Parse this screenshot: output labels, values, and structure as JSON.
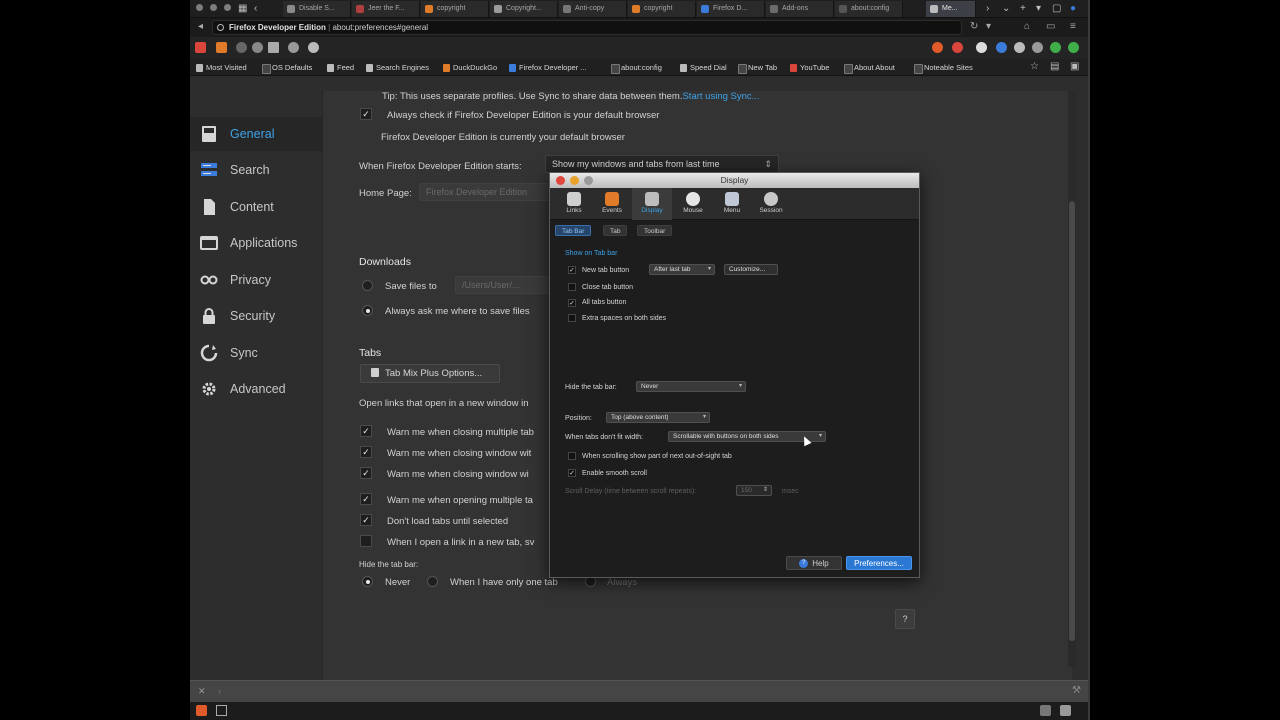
{
  "tabs": [
    {
      "label": "Disable S..."
    },
    {
      "label": "Jeer the F..."
    },
    {
      "label": "copyright"
    },
    {
      "label": "Copyright..."
    },
    {
      "label": "Anti-copy"
    },
    {
      "label": "copyright"
    },
    {
      "label": "Firefox D..."
    },
    {
      "label": "Add-ons"
    },
    {
      "label": "about:config"
    },
    {
      "label": "Me..."
    }
  ],
  "url_bar": {
    "site_name": "Firefox Developer Edition",
    "url": "about:preferences#general"
  },
  "bookmarks": [
    {
      "label": "Most Visited"
    },
    {
      "label": "OS Defaults"
    },
    {
      "label": "Feed"
    },
    {
      "label": "Search Engines"
    },
    {
      "label": "DuckDuckGo"
    },
    {
      "label": "Firefox Developer ..."
    },
    {
      "label": "about:config"
    },
    {
      "label": "Speed Dial"
    },
    {
      "label": "New Tab"
    },
    {
      "label": "YouTube"
    },
    {
      "label": "About About"
    },
    {
      "label": "Noteable Sites"
    }
  ],
  "sidebar": {
    "items": [
      {
        "label": "General",
        "icon": "general-icon"
      },
      {
        "label": "Search",
        "icon": "search-icon"
      },
      {
        "label": "Content",
        "icon": "content-icon"
      },
      {
        "label": "Applications",
        "icon": "applications-icon"
      },
      {
        "label": "Privacy",
        "icon": "privacy-mask-icon"
      },
      {
        "label": "Security",
        "icon": "lock-icon"
      },
      {
        "label": "Sync",
        "icon": "sync-icon"
      },
      {
        "label": "Advanced",
        "icon": "gear-icon"
      }
    ],
    "active_color": "#3da3e8"
  },
  "general": {
    "tip_text": "Tip: This uses separate profiles. Use Sync to share data between them.",
    "tip_link": "Start using Sync...",
    "default_check_label": "Always check if Firefox Developer Edition is your default browser",
    "default_status": "Firefox Developer Edition is currently your default browser",
    "starts_label": "When Firefox Developer Edition starts:",
    "starts_value": "Show my windows and tabs from last time",
    "home_page_label": "Home Page:",
    "home_page_value": "Firefox Developer Edition",
    "downloads_heading": "Downloads",
    "save_files_label": "Save files to",
    "save_files_path": "/Users/User/...",
    "always_ask_label": "Always ask me where to save files",
    "tabs_heading": "Tabs",
    "tmp_button": "Tab Mix Plus Options...",
    "open_links_label": "Open links that open in a new window in",
    "tab_checks": [
      {
        "label": "Warn me when closing multiple tab",
        "checked": true
      },
      {
        "label": "Warn me when closing window wit",
        "checked": true
      },
      {
        "label": "Warn me when closing window wi",
        "checked": true
      },
      {
        "label": "Warn me when opening multiple ta",
        "checked": true
      },
      {
        "label": "Don't load tabs until selected",
        "checked": true
      },
      {
        "label": "When I open a link in a new tab, sv",
        "checked": false
      }
    ],
    "hide_tab_bar_label": "Hide the tab bar:",
    "hide_options": [
      "Never",
      "When I have only one tab",
      "Always"
    ],
    "help_button": "?"
  },
  "dialog": {
    "title": "Display",
    "toolbar": [
      "Links",
      "Events",
      "Display",
      "Mouse",
      "Menu",
      "Session"
    ],
    "subtabs": [
      "Tab Bar",
      "Tab",
      "Toolbar"
    ],
    "group_label": "Show on Tab bar",
    "new_tab_button_label": "New tab button",
    "new_tab_position": "After last tab",
    "customize_button": "Customize...",
    "close_tab_button_label": "Close tab button",
    "all_tabs_button_label": "All tabs button",
    "extra_spaces_label": "Extra spaces on both sides",
    "hide_tab_bar_label": "Hide the tab bar:",
    "hide_tab_bar_value": "Never",
    "position_label": "Position:",
    "position_value": "Top (above content)",
    "fit_label": "When tabs don't fit width:",
    "fit_value": "Scrollable with buttons on both sides",
    "scroll_show_label": "When scrolling show part of next out-of-sight tab",
    "smooth_scroll_label": "Enable smooth scroll",
    "scroll_delay_label": "Scroll Delay (time between scroll repeats):",
    "scroll_delay_value": "150",
    "scroll_delay_unit": "msec",
    "help_button": "Help",
    "preferences_button": "Preferences..."
  }
}
